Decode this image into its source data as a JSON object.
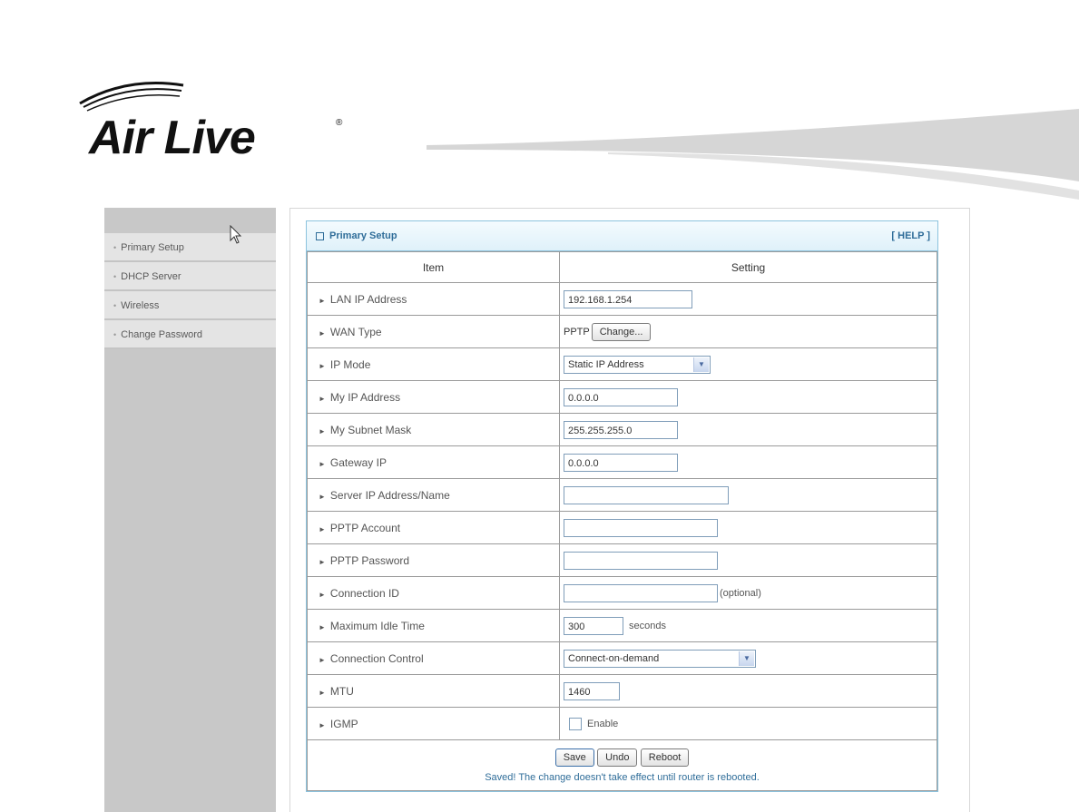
{
  "brand": {
    "name": "Air Live",
    "mark": "®"
  },
  "sidebar": {
    "items": [
      {
        "label": "Primary Setup"
      },
      {
        "label": "DHCP Server"
      },
      {
        "label": "Wireless"
      },
      {
        "label": "Change Password"
      }
    ]
  },
  "panel": {
    "title": "Primary Setup",
    "help": "[ HELP ]",
    "col_item": "Item",
    "col_setting": "Setting"
  },
  "rows": {
    "lan_ip": {
      "label": "LAN IP Address",
      "value": "192.168.1.254"
    },
    "wan_type": {
      "label": "WAN Type",
      "value": "PPTP",
      "button": "Change..."
    },
    "ip_mode": {
      "label": "IP Mode",
      "selected": "Static IP Address"
    },
    "my_ip": {
      "label": "My IP Address",
      "value": "0.0.0.0"
    },
    "subnet": {
      "label": "My Subnet Mask",
      "value": "255.255.255.0"
    },
    "gateway": {
      "label": "Gateway IP",
      "value": "0.0.0.0"
    },
    "server": {
      "label": "Server IP Address/Name",
      "value": ""
    },
    "account": {
      "label": "PPTP Account",
      "value": ""
    },
    "password": {
      "label": "PPTP Password",
      "value": ""
    },
    "conn_id": {
      "label": "Connection ID",
      "value": "",
      "note": "(optional)"
    },
    "idle": {
      "label": "Maximum Idle Time",
      "value": "300",
      "unit": "seconds"
    },
    "control": {
      "label": "Connection Control",
      "selected": "Connect-on-demand"
    },
    "mtu": {
      "label": "MTU",
      "value": "1460"
    },
    "igmp": {
      "label": "IGMP",
      "option": "Enable"
    }
  },
  "actions": {
    "save": "Save",
    "undo": "Undo",
    "reboot": "Reboot",
    "message": "Saved! The change doesn't take effect until router is rebooted."
  }
}
